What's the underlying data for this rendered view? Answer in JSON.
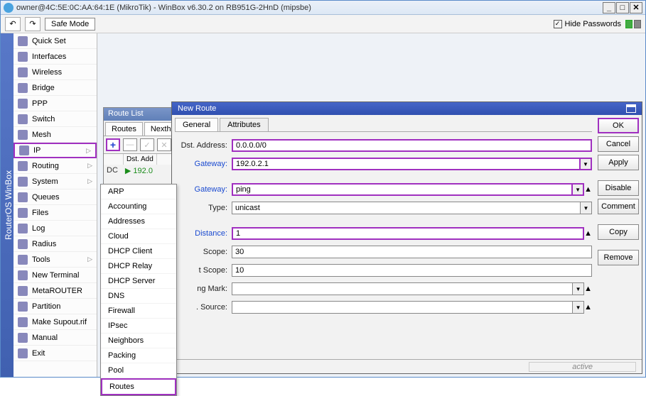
{
  "window": {
    "title": "owner@4C:5E:0C:AA:64:1E (MikroTik) - WinBox v6.30.2 on RB951G-2HnD (mipsbe)"
  },
  "toolbar": {
    "safe_mode": "Safe Mode",
    "hide_pw": "Hide Passwords"
  },
  "vertical": "RouterOS WinBox",
  "sidebar": [
    {
      "label": "Quick Set",
      "arrow": false
    },
    {
      "label": "Interfaces",
      "arrow": false
    },
    {
      "label": "Wireless",
      "arrow": false
    },
    {
      "label": "Bridge",
      "arrow": false
    },
    {
      "label": "PPP",
      "arrow": false
    },
    {
      "label": "Switch",
      "arrow": false
    },
    {
      "label": "Mesh",
      "arrow": false
    },
    {
      "label": "IP",
      "arrow": true,
      "hl": true,
      "name": "ip"
    },
    {
      "label": "Routing",
      "arrow": true
    },
    {
      "label": "System",
      "arrow": true
    },
    {
      "label": "Queues",
      "arrow": false
    },
    {
      "label": "Files",
      "arrow": false
    },
    {
      "label": "Log",
      "arrow": false
    },
    {
      "label": "Radius",
      "arrow": false
    },
    {
      "label": "Tools",
      "arrow": true
    },
    {
      "label": "New Terminal",
      "arrow": false
    },
    {
      "label": "MetaROUTER",
      "arrow": false
    },
    {
      "label": "Partition",
      "arrow": false
    },
    {
      "label": "Make Supout.rif",
      "arrow": false
    },
    {
      "label": "Manual",
      "arrow": false
    },
    {
      "label": "Exit",
      "arrow": false
    }
  ],
  "submenu": [
    "ARP",
    "Accounting",
    "Addresses",
    "Cloud",
    "DHCP Client",
    "DHCP Relay",
    "DHCP Server",
    "DNS",
    "Firewall",
    "IPsec",
    "Neighbors",
    "Packing",
    "Pool",
    "Routes"
  ],
  "submenu_hl": "Routes",
  "route_list": {
    "title": "Route List",
    "tabs": [
      "Routes",
      "Nextho"
    ],
    "header": [
      "",
      "Dst. Add"
    ],
    "row": {
      "flags": "DC",
      "dst": "192.0"
    }
  },
  "new_route": {
    "title": "New Route",
    "tabs": [
      "General",
      "Attributes"
    ],
    "fields": {
      "dst_address": {
        "label": "Dst. Address:",
        "value": "0.0.0.0/0",
        "hl": true
      },
      "gateway": {
        "label": "Gateway:",
        "value": "192.0.2.1",
        "hl": true,
        "hl_label": true,
        "dd": true
      },
      "check_gateway": {
        "label": "Gateway:",
        "value": "ping",
        "hl": true,
        "hl_label": true,
        "dd": true,
        "arrow": true
      },
      "type": {
        "label": "Type:",
        "value": "unicast",
        "dd": true
      },
      "distance": {
        "label": "Distance:",
        "value": "1",
        "hl": true,
        "hl_label": true,
        "arrow": true
      },
      "scope": {
        "label": "Scope:",
        "value": "30"
      },
      "target_scope": {
        "label": "t Scope:",
        "value": "10"
      },
      "routing_mark": {
        "label": "ng Mark:",
        "value": "",
        "dd": true,
        "arrow": true
      },
      "pref_source": {
        "label": ". Source:",
        "value": "",
        "dd": true,
        "arrow": true
      }
    },
    "buttons": [
      "OK",
      "Cancel",
      "Apply",
      "Disable",
      "Comment",
      "Copy",
      "Remove"
    ],
    "status": "active"
  }
}
